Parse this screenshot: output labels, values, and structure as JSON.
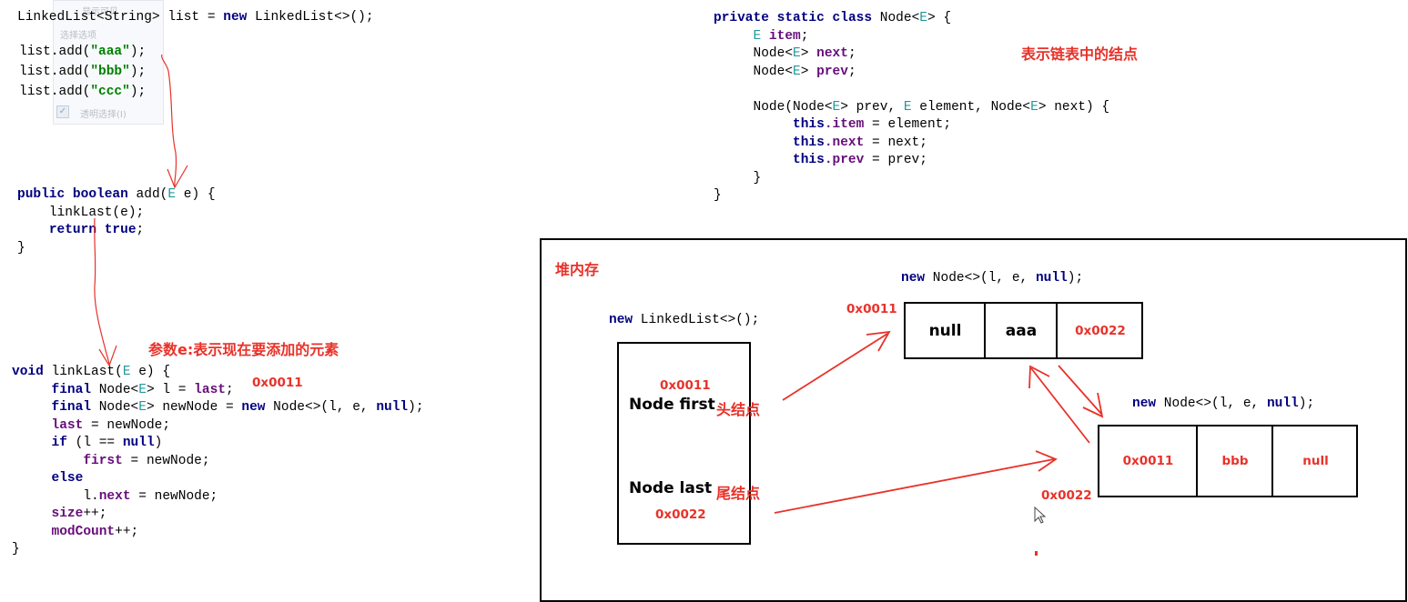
{
  "code_top_left": {
    "line1": {
      "t1": "LinkedList<String> list = ",
      "kw_new": "new",
      "t2": " LinkedList<>();"
    },
    "add_lines": [
      {
        "prefix": "list.add(",
        "str": "\"aaa\"",
        "suffix": ");"
      },
      {
        "prefix": "list.add(",
        "str": "\"bbb\"",
        "suffix": ");"
      },
      {
        "prefix": "list.add(",
        "str": "\"ccc\"",
        "suffix": ");"
      }
    ]
  },
  "ghost_panel": {
    "line1": "显示可见",
    "line2": "选择选项",
    "line3": "透明选择(I)"
  },
  "code_add_method": {
    "kw_public": "public",
    "kw_boolean": "boolean",
    "sig_mid": " add(",
    "type_e": "E",
    "sig_end": " e) {",
    "body1": "linkLast(e);",
    "kw_return": "return",
    "kw_true": "true",
    "body2_end": ";",
    "close": "}"
  },
  "code_linklast": {
    "kw_void": "void",
    "sig_mid": " linkLast(",
    "type_e": "E",
    "sig_end": " e) {",
    "l1_kw": "final",
    "l1_a": " Node<",
    "l1_e": "E",
    "l1_b": "> l = ",
    "l1_fld": "last",
    "l1_c": ";",
    "l2_kw": "final",
    "l2_a": " Node<",
    "l2_e": "E",
    "l2_b": "> newNode = ",
    "l2_new": "new",
    "l2_c": " Node<>(l, e, ",
    "l2_null": "null",
    "l2_d": ");",
    "l3_fld": "last",
    "l3_a": " = newNode;",
    "l4_kw": "if",
    "l4_a": " (l == ",
    "l4_null": "null",
    "l4_b": ")",
    "l5_fld": "first",
    "l5_a": " = newNode;",
    "l6_kw": "else",
    "l7_a": "l.",
    "l7_fld": "next",
    "l7_b": " = newNode;",
    "l8_fld": "size",
    "l8_a": "++;",
    "l9_fld": "modCount",
    "l9_a": "++;",
    "close": "}"
  },
  "code_node_class": {
    "kw_private": "private",
    "kw_static": "static",
    "kw_class": "class",
    "sig_a": " Node<",
    "type_e": "E",
    "sig_b": "> {",
    "f1_e": "E",
    "f1_fld": "item",
    "f1_end": ";",
    "f2_a": "Node<",
    "f2_e": "E",
    "f2_b": "> ",
    "f2_fld": "next",
    "f2_end": ";",
    "f3_a": "Node<",
    "f3_e": "E",
    "f3_b": "> ",
    "f3_fld": "prev",
    "f3_end": ";",
    "ctor_a": "Node(Node<",
    "ctor_e1": "E",
    "ctor_b": "> prev, ",
    "ctor_e2": "E",
    "ctor_c": " element, Node<",
    "ctor_e3": "E",
    "ctor_d": "> next) {",
    "c1_kw": "this",
    "c1_fld": ".item",
    "c1_end": " = element;",
    "c2_kw": "this",
    "c2_fld": ".next",
    "c2_end": " = next;",
    "c3_kw": "this",
    "c3_fld": ".prev",
    "c3_end": " = prev;",
    "inner_close": "}",
    "outer_close": "}"
  },
  "annotations": {
    "node_comment": "表示链表中的结点",
    "param_comment": "参数e:表示现在要添加的元素",
    "linklast_addr": "0x0011"
  },
  "heap": {
    "title": "堆内存",
    "linkedlist_label": {
      "kw": "new",
      "rest": " LinkedList<>();"
    },
    "linkedlist_box": {
      "first_addr": "0x0011",
      "first_label": "Node first",
      "first_note": "头结点",
      "last_label": "Node last",
      "last_note": "尾结点",
      "last_addr": "0x0022"
    },
    "node1": {
      "label_kw": "new",
      "label_a": " Node<>(l, e, ",
      "label_null": "null",
      "label_b": ");",
      "addr": "0x0011",
      "prev": "null",
      "item": "aaa",
      "next": "0x0022"
    },
    "node2": {
      "label_kw": "new",
      "label_a": " Node<>(l, e, ",
      "label_null": "null",
      "label_b": ");",
      "addr": "0x0022",
      "prev": "0x0011",
      "item": "bbb",
      "next": "null"
    }
  },
  "colors": {
    "keyword": "#000080",
    "string": "#008000",
    "type_param": "#20999d",
    "field": "#660e7a",
    "annotation_red": "#e8322a"
  },
  "icons": [
    "mouse-cursor-icon",
    "checkbox-icon"
  ]
}
